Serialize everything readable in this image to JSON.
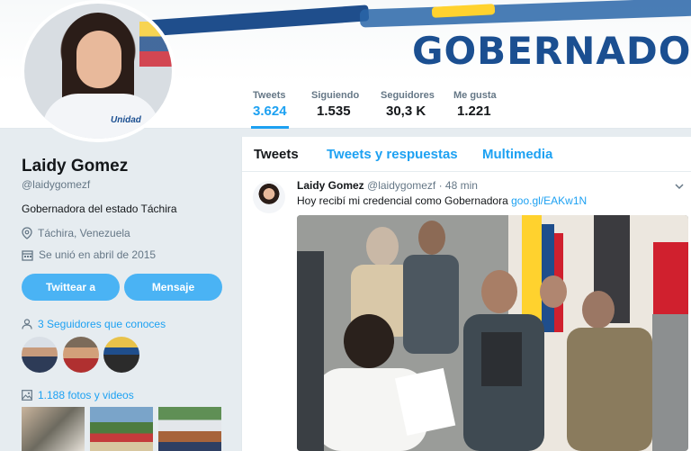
{
  "banner": {
    "brand_text": "GOBERNADO"
  },
  "nav": {
    "stats": [
      {
        "label": "Tweets",
        "value": "3.624"
      },
      {
        "label": "Siguiendo",
        "value": "1.535"
      },
      {
        "label": "Seguidores",
        "value": "30,3 K"
      },
      {
        "label": "Me gusta",
        "value": "1.221"
      }
    ]
  },
  "profile": {
    "avatar_badge": "Unidad",
    "name": "Laidy Gomez",
    "handle": "@laidygomezf",
    "bio": "Gobernadora del estado Táchira",
    "location": "Táchira, Venezuela",
    "joined": "Se unió en abril de 2015",
    "tweet_button": "Twittear a",
    "message_button": "Mensaje",
    "followers_you_know": "3 Seguidores que conoces",
    "photos_videos": "1.188 fotos y videos"
  },
  "timeline": {
    "tabs": [
      "Tweets",
      "Tweets y respuestas",
      "Multimedia"
    ],
    "tweet": {
      "author": "Laidy Gomez",
      "handle": "@laidygomezf",
      "time": "· 48 min",
      "text": "Hoy recibí mi credencial  como Gobernadora ",
      "link": "goo.gl/EAKw1N"
    }
  },
  "colors": {
    "accent": "#1da1f2",
    "button": "#4ab3f4",
    "brand": "#1b4f91"
  }
}
